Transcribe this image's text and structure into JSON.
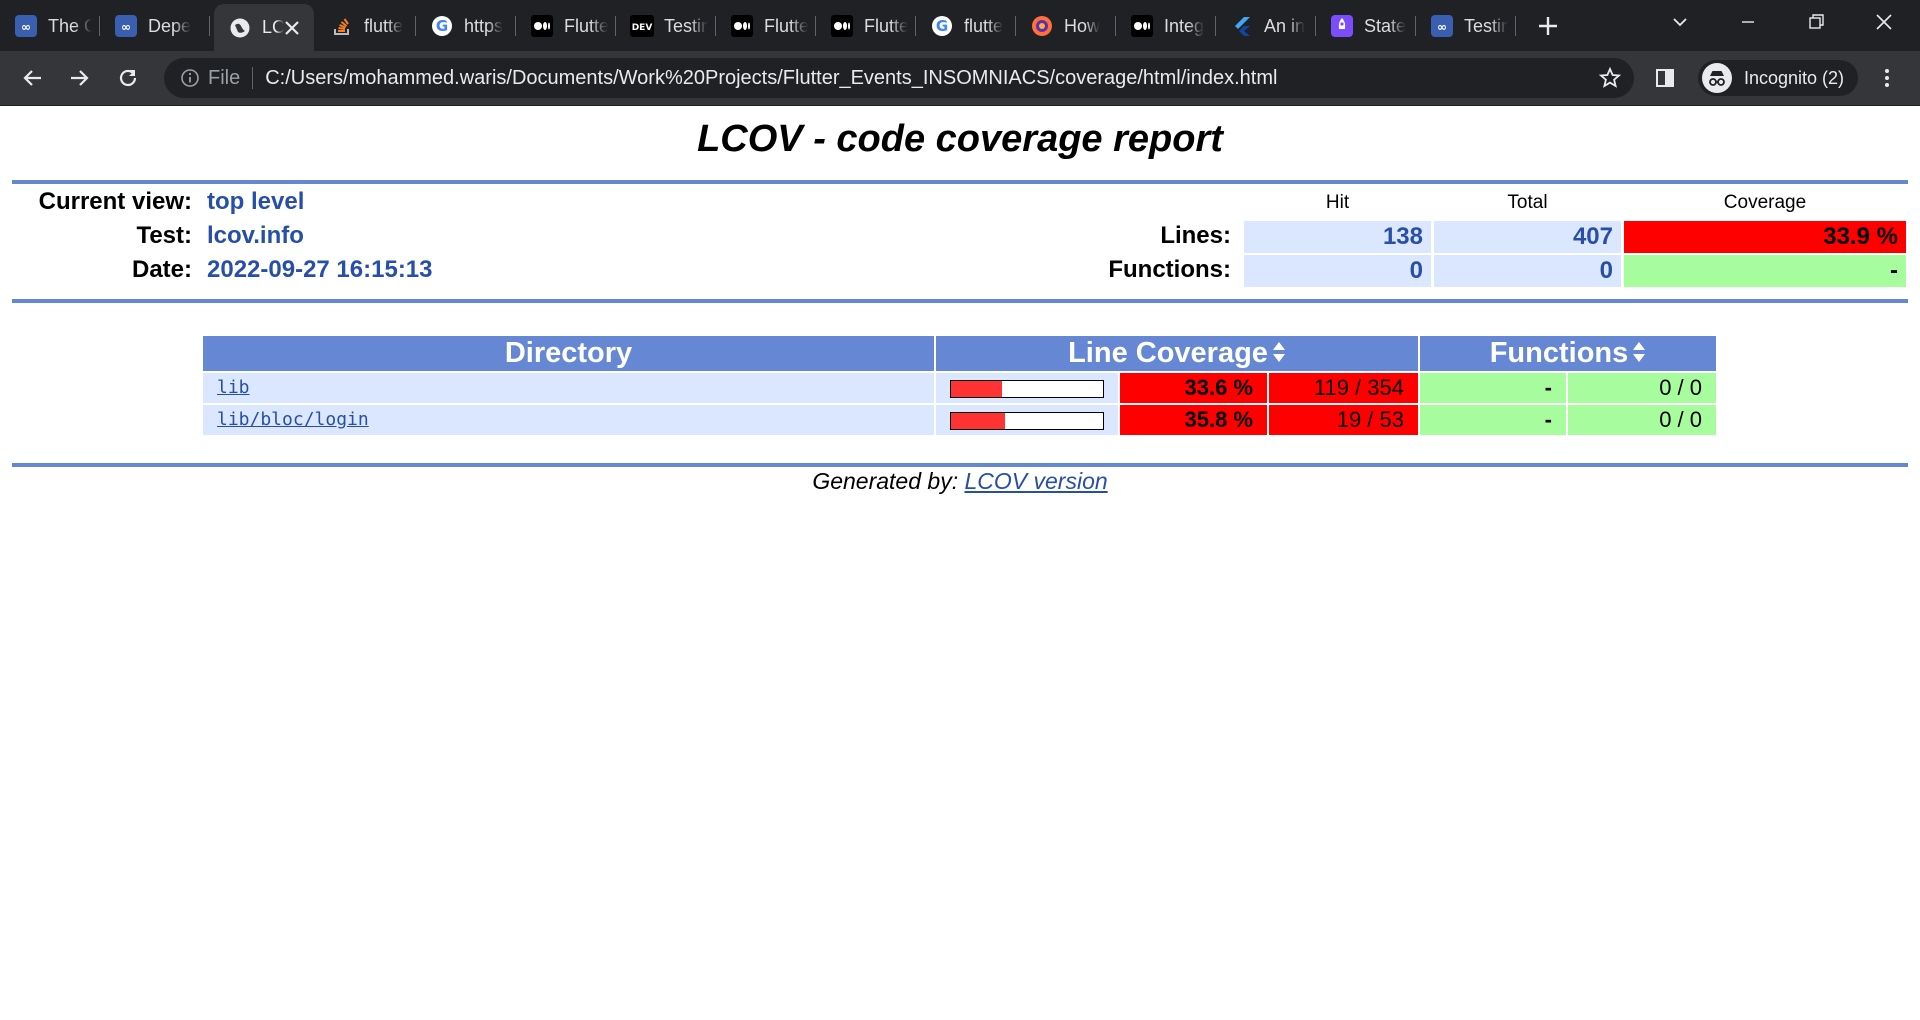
{
  "browser": {
    "tabs": [
      {
        "title": "The C",
        "icon": "codemagic-icon"
      },
      {
        "title": "Depe",
        "icon": "codemagic-icon"
      },
      {
        "title": "LCOV",
        "icon": "globe-icon",
        "active": true
      },
      {
        "title": "flutte",
        "icon": "stackoverflow-icon"
      },
      {
        "title": "https",
        "icon": "google-icon"
      },
      {
        "title": "Flutte",
        "icon": "medium-icon"
      },
      {
        "title": "Testin",
        "icon": "dev-icon"
      },
      {
        "title": "Flutte",
        "icon": "medium-icon"
      },
      {
        "title": "Flutte",
        "icon": "medium-icon"
      },
      {
        "title": "flutte",
        "icon": "google-icon"
      },
      {
        "title": "How",
        "icon": "firefox-icon"
      },
      {
        "title": "Integ",
        "icon": "medium-icon"
      },
      {
        "title": "An in",
        "icon": "flutter-icon"
      },
      {
        "title": "State",
        "icon": "rocket-icon"
      },
      {
        "title": "Testin",
        "icon": "codemagic-icon"
      }
    ],
    "address": {
      "scheme_label": "File",
      "url": "C:/Users/mohammed.waris/Documents/Work%20Projects/Flutter_Events_INSOMNIACS/coverage/html/index.html"
    },
    "profile_label": "Incognito (2)"
  },
  "report": {
    "title": "LCOV - code coverage report",
    "current_view_label": "Current view:",
    "current_view_value": "top level",
    "test_label": "Test:",
    "test_value": "lcov.info",
    "date_label": "Date:",
    "date_value": "2022-09-27 16:15:13",
    "col_hit": "Hit",
    "col_total": "Total",
    "col_coverage": "Coverage",
    "lines_label": "Lines:",
    "lines_hit": "138",
    "lines_total": "407",
    "lines_coverage": "33.9 %",
    "functions_label": "Functions:",
    "functions_hit": "0",
    "functions_total": "0",
    "functions_coverage": "-"
  },
  "table": {
    "headers": {
      "directory": "Directory",
      "line_coverage": "Line Coverage",
      "functions": "Functions"
    },
    "rows": [
      {
        "directory": "lib",
        "bar_fraction": 0.336,
        "percent": "33.6 %",
        "lines": "119 / 354",
        "func_percent": "-",
        "funcs": "0 / 0"
      },
      {
        "directory": "lib/bloc/login",
        "bar_fraction": 0.358,
        "percent": "35.8 %",
        "lines": "19 / 53",
        "func_percent": "-",
        "funcs": "0 / 0"
      }
    ]
  },
  "footer": {
    "prefix": "Generated by:",
    "link": "LCOV version"
  },
  "colors": {
    "rule_blue": "#6688d4",
    "cell_blue": "#dae7fe",
    "low_red": "#ff0000",
    "hi_green": "#a7fc9d",
    "text_blue": "#284fa8"
  }
}
